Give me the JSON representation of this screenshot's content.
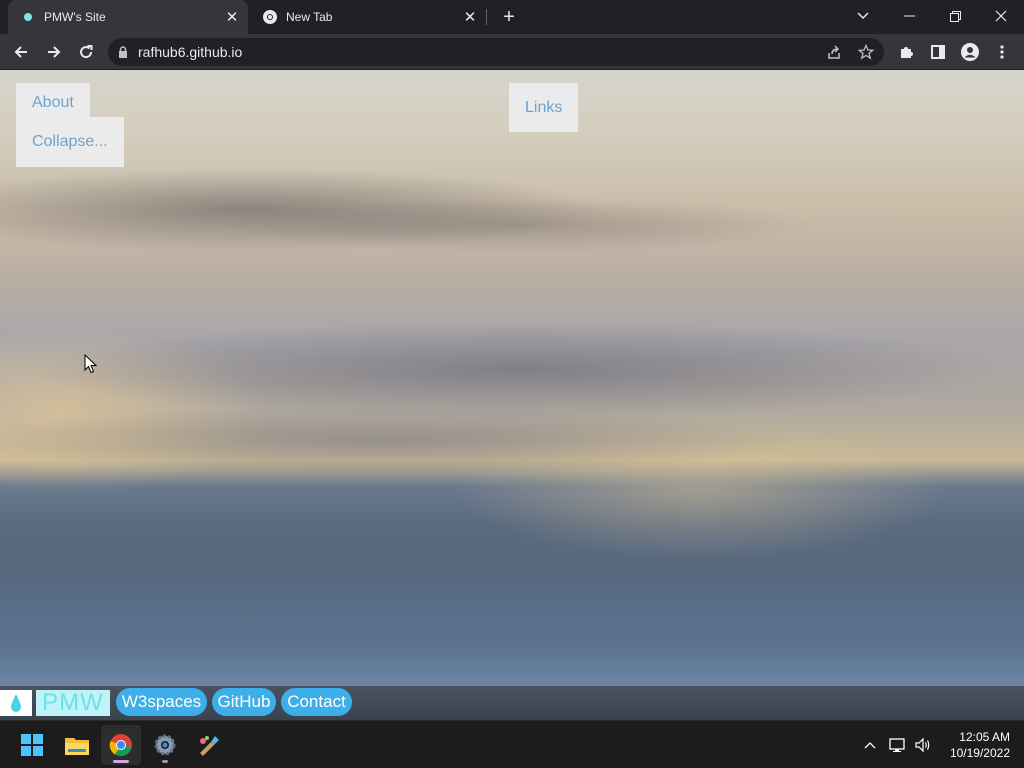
{
  "browser": {
    "tabs": [
      {
        "title": "PMW's Site",
        "active": true,
        "favicon": "pmw-drop-icon"
      },
      {
        "title": "New Tab",
        "active": false,
        "favicon": "chrome-icon"
      }
    ],
    "new_tab_label": "+",
    "address": "rafhub6.github.io"
  },
  "page": {
    "nav": {
      "about": "About",
      "collapse": "Collapse...",
      "links": "Links"
    },
    "footer": {
      "logo_text": "PMW",
      "links": [
        "W3spaces",
        "GitHub",
        "Contact"
      ]
    },
    "colors": {
      "nav_text": "#6ea3cf",
      "pill_bg": "#3daee8",
      "logo_text": "#6ee0ea"
    }
  },
  "taskbar": {
    "apps": [
      "windows-start-icon",
      "file-explorer-icon",
      "chrome-icon",
      "settings-icon",
      "paint-icon"
    ],
    "time": "12:05 AM",
    "date": "10/19/2022"
  }
}
